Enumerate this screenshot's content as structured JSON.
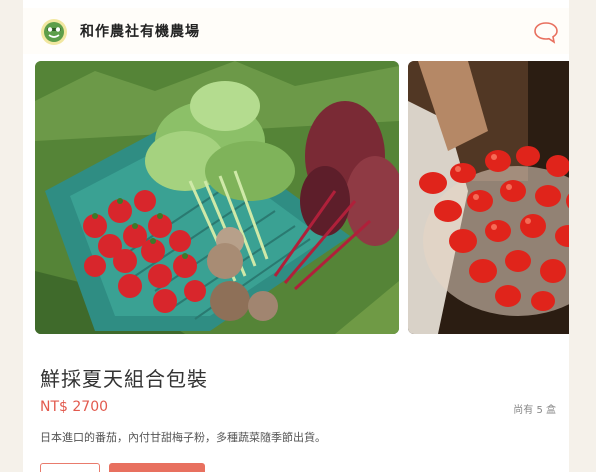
{
  "shop": {
    "name": "和作農社有機農場",
    "logo_icon": "farm-logo-icon",
    "chat_icon": "chat-bubble-icon"
  },
  "gallery": {
    "images": [
      {
        "subject": "vegetable-crate-image"
      },
      {
        "subject": "cherry-tomatoes-image"
      }
    ]
  },
  "product": {
    "title": "鮮採夏天組合包裝",
    "price": "NT$ 2700",
    "stock": "尚有 5 盒",
    "description": "日本進口的番茄，內付甘甜梅子粉，多種蔬菜隨季節出貨。"
  },
  "colors": {
    "accent": "#e8705f",
    "price": "#e25a4e",
    "background": "#f5f1ea"
  }
}
